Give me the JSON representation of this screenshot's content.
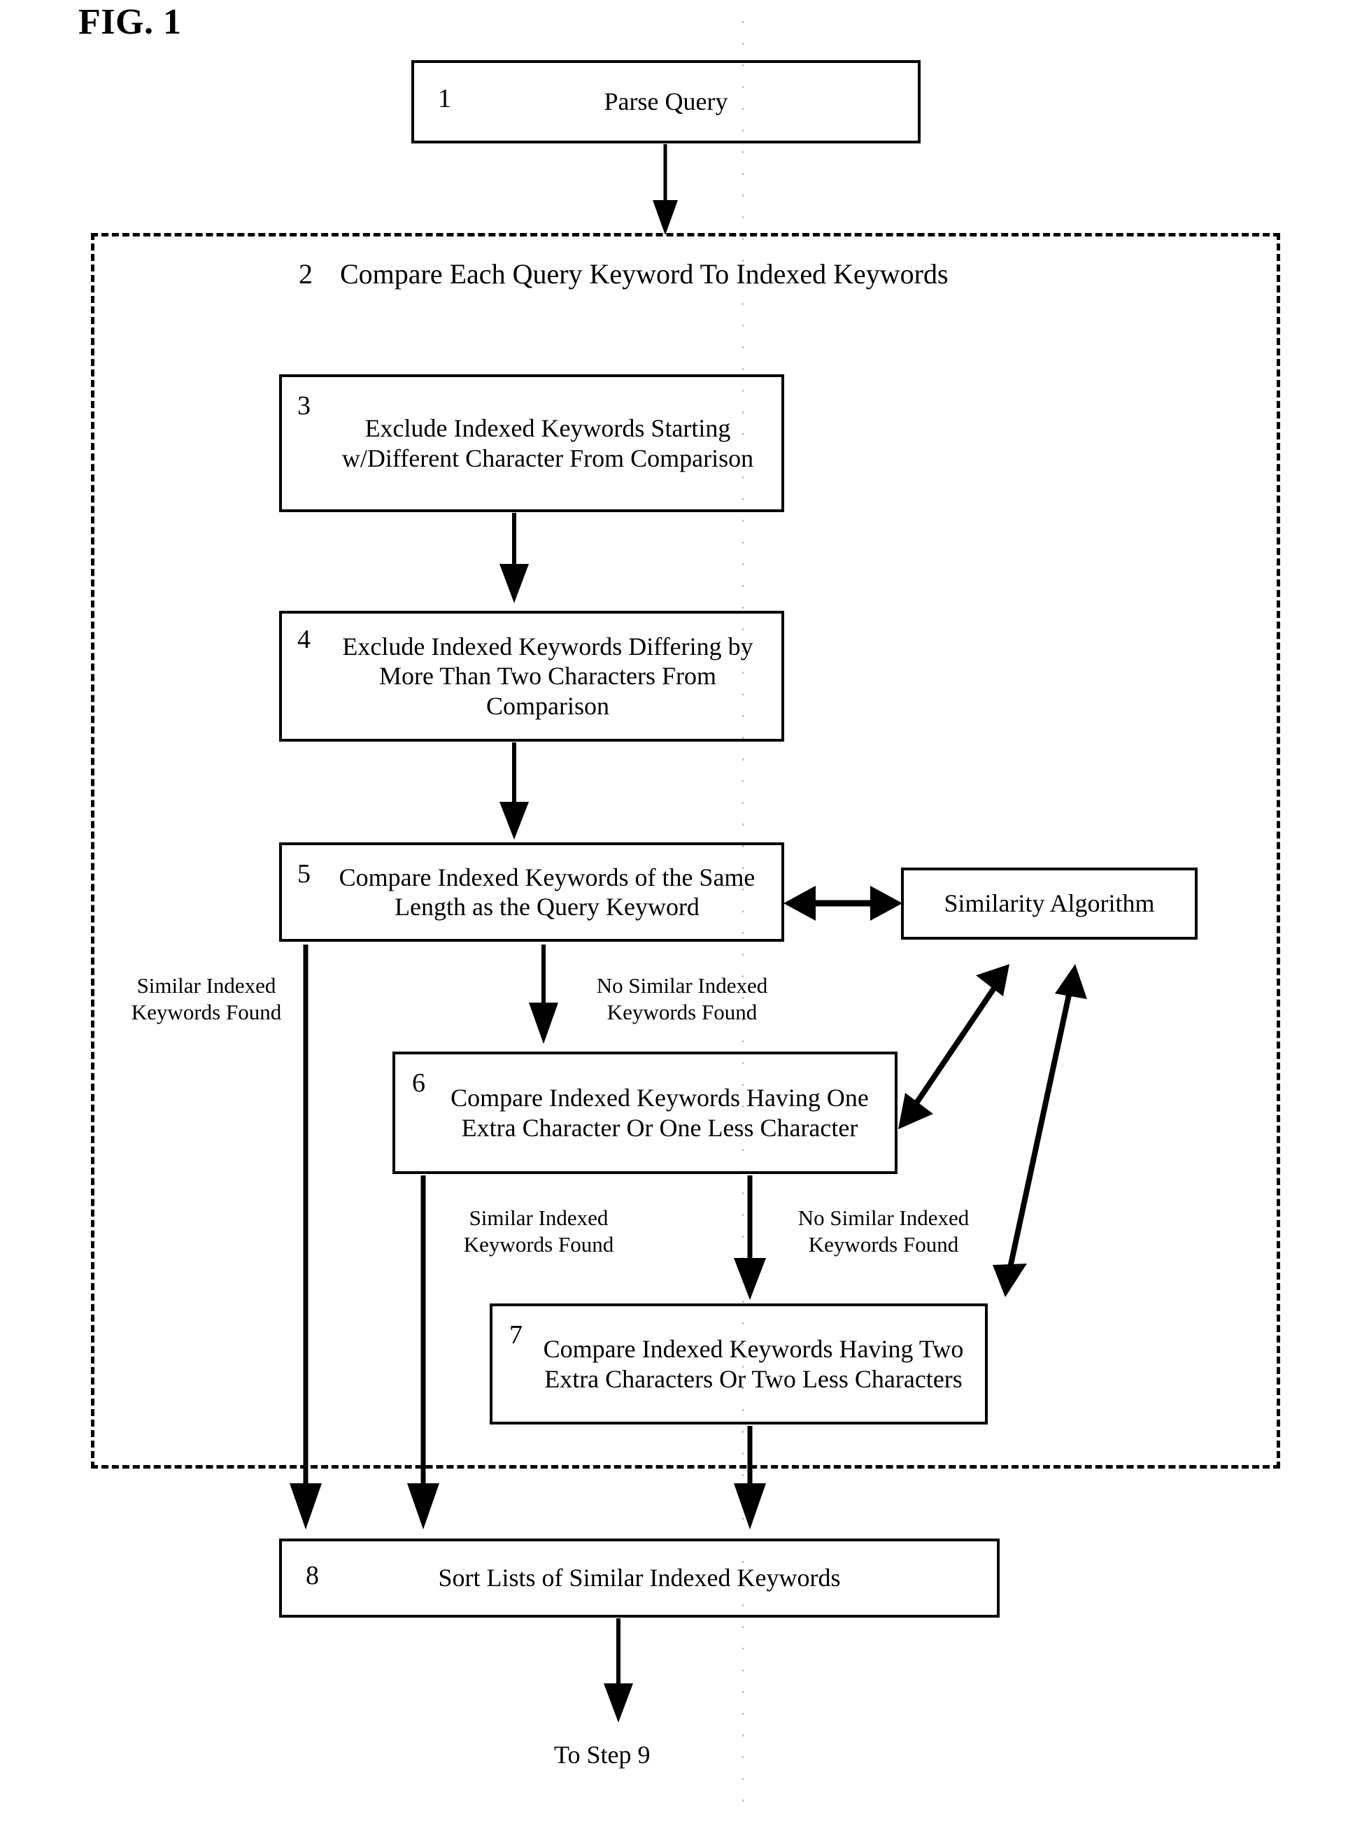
{
  "figure": {
    "title": "FIG. 1"
  },
  "nodes": [
    {
      "id": "step1",
      "number": "1",
      "label": "Parse Query"
    },
    {
      "id": "step3",
      "number": "3",
      "label": "Exclude Indexed Keywords Starting w/Different Character From Comparison"
    },
    {
      "id": "step4",
      "number": "4",
      "label": "Exclude Indexed Keywords Differing by More Than Two Characters From Comparison"
    },
    {
      "id": "step5",
      "number": "5",
      "label": "Compare Indexed Keywords of the Same Length as the Query Keyword"
    },
    {
      "id": "step6",
      "number": "6",
      "label": "Compare Indexed Keywords Having One Extra Character Or One Less Character"
    },
    {
      "id": "step7",
      "number": "7",
      "label": "Compare Indexed Keywords Having Two Extra Characters Or Two Less Characters"
    },
    {
      "id": "step8",
      "number": "8",
      "label": "Sort Lists of Similar Indexed Keywords"
    },
    {
      "id": "similarity",
      "number": "",
      "label": "Similarity Algorithm"
    }
  ],
  "group": {
    "number": "2",
    "label": "Compare Each Query Keyword To Indexed Keywords"
  },
  "edge_labels": [
    {
      "id": "label-similar-found-left",
      "line1": "Similar Indexed",
      "line2": "Keywords Found"
    },
    {
      "id": "label-no-similar-found-step5",
      "line1": "No Similar Indexed",
      "line2": "Keywords Found"
    },
    {
      "id": "label-similar-found-step6",
      "line1": "Similar Indexed",
      "line2": "Keywords Found"
    },
    {
      "id": "label-no-similar-found-step6",
      "line1": "No Similar Indexed",
      "line2": "Keywords Found"
    }
  ],
  "terminal": {
    "label": "To Step 9"
  },
  "colors": {
    "stroke": "#000000",
    "background": "#ffffff"
  }
}
